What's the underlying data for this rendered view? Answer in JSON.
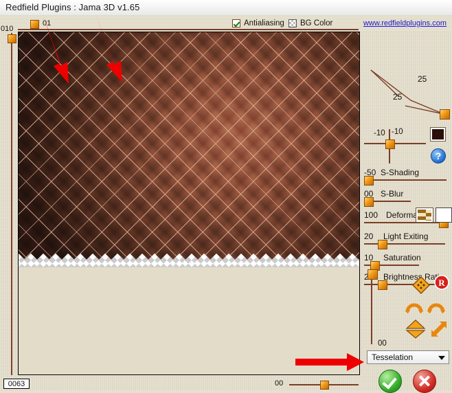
{
  "window": {
    "title": "Redfield Plugins : Jama 3D  v1.65"
  },
  "toolbar": {
    "top_slider_label": "01",
    "antialiasing_label": "Antialiasing",
    "bg_color_label": "BG Color",
    "antialiasing_checked": true,
    "bg_color_checked": false,
    "website": "www.redfieldplugins.com"
  },
  "left_slider": {
    "label": "010"
  },
  "status": {
    "value": "0063",
    "bottom_slider_label": "00"
  },
  "right_panel": {
    "angle": {
      "value_a": "25",
      "value_b": "25"
    },
    "offset": {
      "value_x": "-10",
      "value_y": "-10"
    },
    "sliders": [
      {
        "value": "-50",
        "name": "S-Shading"
      },
      {
        "value": "00",
        "name": "S-Blur"
      },
      {
        "value": "100",
        "name": "Deformation"
      },
      {
        "value": "20",
        "name": "Light Exiting"
      },
      {
        "value": "10",
        "name": "Saturation"
      },
      {
        "value": "20",
        "name": "Brightness Ratio"
      }
    ],
    "vertical_slider_label": "00",
    "mode_select": {
      "selected": "Tesselation"
    },
    "buttons": {
      "ok": "OK",
      "cancel": "Cancel"
    },
    "icons": {
      "move": "move-diamond-icon",
      "registered": "registered-r-icon",
      "rotate_left": "rotate-left-icon",
      "rotate_right": "rotate-right-icon",
      "flip_vertical": "flip-vertical-icon",
      "resize": "resize-diagonal-icon",
      "help": "?",
      "color_swatch": "#2a0f0b"
    }
  },
  "colors": {
    "panel_bg": "#e3dcc9",
    "slider_track": "#7a3f24",
    "handle": "#f09a16",
    "link": "#1a1ad0",
    "arrow": "#ee0000"
  }
}
